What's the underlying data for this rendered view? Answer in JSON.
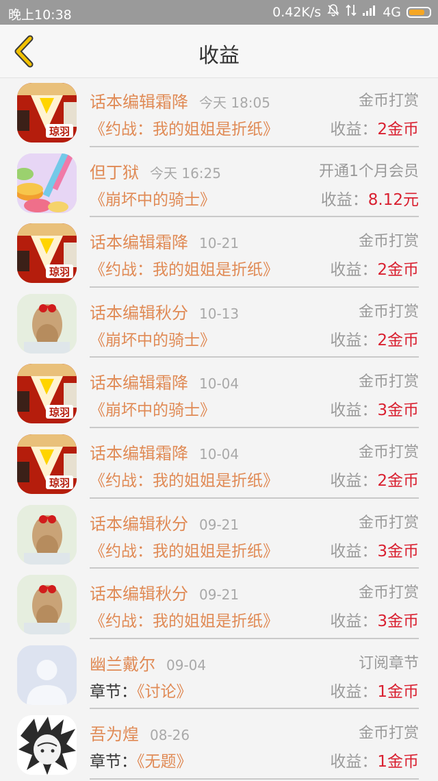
{
  "status_bar": {
    "time": "晚上10:38",
    "network_speed": "0.42K/s",
    "network_type": "4G",
    "battery_color": "#f5a623"
  },
  "nav": {
    "title": "收益",
    "back_icon": "chevron-left-icon",
    "back_color": "#f2c100"
  },
  "earn_label": "收益：",
  "rows": [
    {
      "name": "话本编辑霜降",
      "date": "今天 18:05",
      "type": "金币打赏",
      "prefix": "",
      "book": "《约战：我的姐姐是折纸》",
      "amount": "2金币",
      "avatar": "editor"
    },
    {
      "name": "但丁狱",
      "date": "今天 16:25",
      "type": "开通1个月会员",
      "prefix": "",
      "book": "《崩坏中的骑士》",
      "amount": "8.12元",
      "avatar": "candy"
    },
    {
      "name": "话本编辑霜降",
      "date": "10-21",
      "type": "金币打赏",
      "prefix": "",
      "book": "《约战：我的姐姐是折纸》",
      "amount": "2金币",
      "avatar": "editor"
    },
    {
      "name": "话本编辑秋分",
      "date": "10-13",
      "type": "金币打赏",
      "prefix": "",
      "book": "《崩坏中的骑士》",
      "amount": "2金币",
      "avatar": "girl"
    },
    {
      "name": "话本编辑霜降",
      "date": "10-04",
      "type": "金币打赏",
      "prefix": "",
      "book": "《崩坏中的骑士》",
      "amount": "3金币",
      "avatar": "editor"
    },
    {
      "name": "话本编辑霜降",
      "date": "10-04",
      "type": "金币打赏",
      "prefix": "",
      "book": "《约战：我的姐姐是折纸》",
      "amount": "2金币",
      "avatar": "editor"
    },
    {
      "name": "话本编辑秋分",
      "date": "09-21",
      "type": "金币打赏",
      "prefix": "",
      "book": "《约战：我的姐姐是折纸》",
      "amount": "3金币",
      "avatar": "girl"
    },
    {
      "name": "话本编辑秋分",
      "date": "09-21",
      "type": "金币打赏",
      "prefix": "",
      "book": "《约战：我的姐姐是折纸》",
      "amount": "3金币",
      "avatar": "girl"
    },
    {
      "name": "幽兰戴尔",
      "date": "09-04",
      "type": "订阅章节",
      "prefix": "章节：",
      "book": "《讨论》",
      "amount": "1金币",
      "avatar": "default"
    },
    {
      "name": "吾为煌",
      "date": "08-26",
      "type": "金币打赏",
      "prefix": "章节：",
      "book": "《无题》",
      "amount": "1金币",
      "avatar": "sketch"
    }
  ],
  "avatar_badge_text": "琼羽",
  "colors": {
    "name": "#e08a55",
    "amount": "#d92030",
    "muted": "#9a9a9a"
  }
}
